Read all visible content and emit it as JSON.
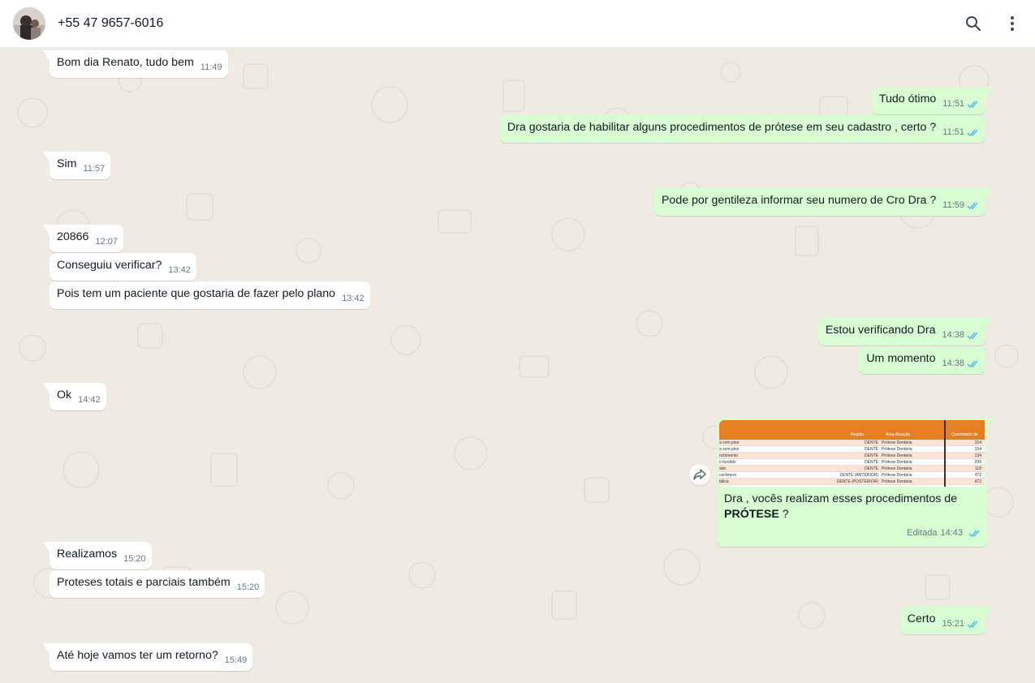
{
  "contact": {
    "name": "+55 47 9657-6016"
  },
  "icons": {
    "search": "search-icon",
    "menu": "menu-icon",
    "read": "double-check-icon",
    "forward": "forward-icon"
  },
  "colors": {
    "incoming_bubble": "#ffffff",
    "outgoing_bubble": "#d9fdd3",
    "read_ticks": "#53bdeb",
    "chat_bg": "#efeae2"
  },
  "messages": [
    {
      "dir": "in",
      "text": "Bom dia Renato, tudo bem",
      "time": "11:49"
    },
    {
      "dir": "out",
      "text": "Tudo ótimo",
      "time": "11:51"
    },
    {
      "dir": "out",
      "text": "Dra gostaria de habilitar alguns procedimentos de prótese em seu cadastro , certo ?",
      "time": "11:51"
    },
    {
      "dir": "in",
      "text": "Sim",
      "time": "11:57"
    },
    {
      "dir": "out",
      "text": "Pode por gentileza informar seu numero de Cro Dra ?",
      "time": "11:59"
    },
    {
      "dir": "in",
      "text": "20866",
      "time": "12:07"
    },
    {
      "dir": "in",
      "text": "Conseguiu verificar?",
      "time": "13:42"
    },
    {
      "dir": "in",
      "text": "Pois tem um paciente que gostaria de fazer pelo plano",
      "time": "13:42"
    },
    {
      "dir": "out",
      "text": "Estou verificando Dra",
      "time": "14:38"
    },
    {
      "dir": "out",
      "text": "Um momento",
      "time": "14:38"
    },
    {
      "dir": "in",
      "text": "Ok",
      "time": "14:42"
    },
    {
      "dir": "in",
      "text": "Realizamos",
      "time": "15:20"
    },
    {
      "dir": "in",
      "text": "Proteses totais e parciais também",
      "time": "15:20"
    },
    {
      "dir": "out",
      "text": "Certo",
      "time": "15:21"
    },
    {
      "dir": "in",
      "text": "Até hoje vamos ter um retorno?",
      "time": "15:49"
    }
  ],
  "image_message": {
    "caption_start": "Dra , vocês realizam esses procedimentos de",
    "caption_bold": "PRÓTESE",
    "caption_end": " ?",
    "edited_label": "Editada",
    "time": "14:43",
    "sheet": {
      "headers": [
        "Região",
        "Área Atuação",
        "Quantidade de"
      ],
      "rows": [
        [
          "a com pino",
          "DENTE",
          "Prótese Dentária",
          "154"
        ],
        [
          "a sem pino",
          "DENTE",
          "Prótese Dentária",
          "154"
        ],
        [
          "nchimento",
          "DENTE",
          "Prótese Dentária",
          "134"
        ],
        [
          "o fundido",
          "DENTE",
          "Prótese Dentária",
          "299"
        ],
        [
          "ado",
          "DENTE",
          "Prótese Dentária",
          "118"
        ],
        [
          "cerômero",
          "DENTE (ANTERIOR)",
          "Prótese Dentária",
          "472"
        ],
        [
          "tálica",
          "DENTE (POSTERIOR)",
          "Prótese Dentária",
          "472"
        ]
      ]
    }
  }
}
